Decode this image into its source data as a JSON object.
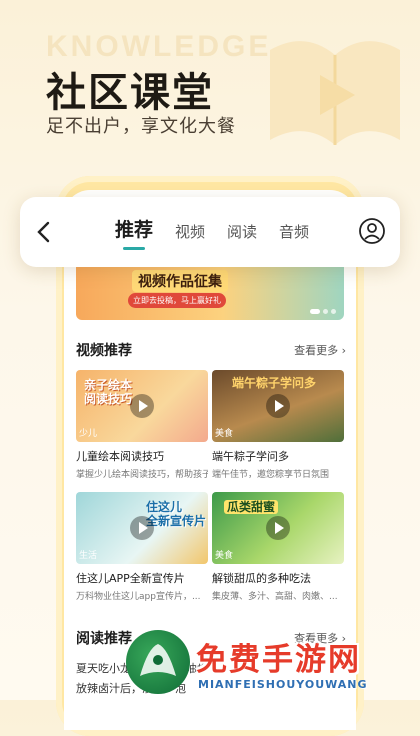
{
  "hero": {
    "bg_word": "KNOWLEDGE",
    "title": "社区课堂",
    "subtitle": "足不出户，享文化大餐"
  },
  "navbar": {
    "tabs": [
      {
        "label": "推荐",
        "active": true
      },
      {
        "label": "视频",
        "active": false
      },
      {
        "label": "阅读",
        "active": false
      },
      {
        "label": "音频",
        "active": false
      }
    ]
  },
  "banner": {
    "title": "视频作品征集",
    "sub": "立即去投稿，马上赢好礼"
  },
  "video_section": {
    "title": "视频推荐",
    "more": "查看更多"
  },
  "videos": [
    {
      "thumb_text": "亲子绘本\n阅读技巧",
      "tag": "少儿",
      "title": "儿童绘本阅读技巧",
      "desc": "掌握少儿绘本阅读技巧，帮助孩子..."
    },
    {
      "thumb_text": "端午粽子学问多",
      "tag": "美食",
      "title": "端午粽子学问多",
      "desc": "端午佳节，邀您粽享节日氛围"
    },
    {
      "thumb_text": "住这儿\n全新宣传片",
      "tag": "生活",
      "title": "住这儿APP全新宣传片",
      "desc": "万科物业住这儿app宣传片，..."
    },
    {
      "thumb_text": "瓜类甜蜜",
      "tag": "美食",
      "title": "解锁甜瓜的多种吃法",
      "desc": "集皮薄、多汁、高甜、肉嫩、..."
    }
  ],
  "read_section": {
    "title": "阅读推荐",
    "more": "查看更多"
  },
  "reads": [
    {
      "text": "夏天吃小龙虾，如何不油炸"
    },
    {
      "text": "放辣卤汁后，浸泡一泡"
    }
  ],
  "watermark": {
    "text": "免费手游网",
    "en": "MIANFEISHOUYOUWANG"
  },
  "colors": {
    "accent": "#2aa9a6",
    "bg": "#fbf1d8",
    "phone_frame": "#ffe7a3"
  }
}
